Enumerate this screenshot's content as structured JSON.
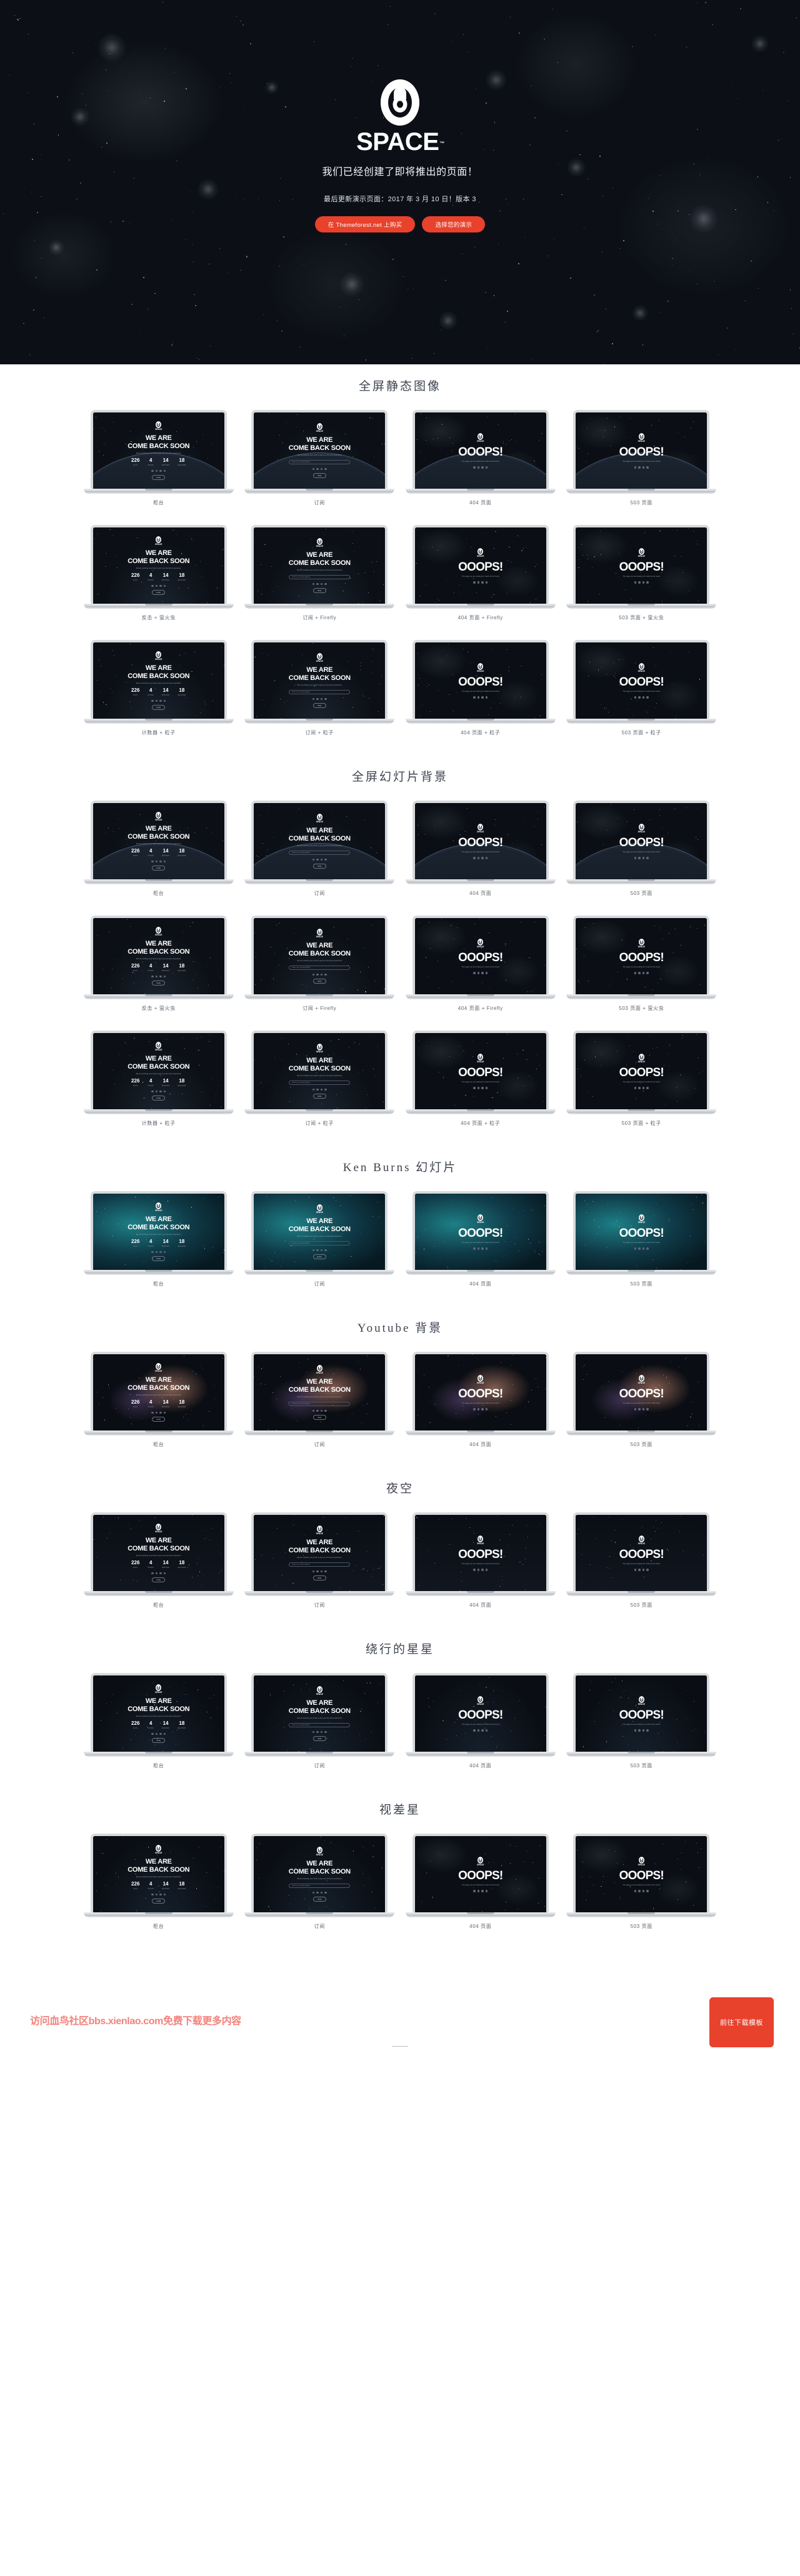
{
  "hero": {
    "logo_icon": "space-ring-keyhole-logo",
    "logo_word": "SPACE",
    "logo_tm": "™",
    "tagline": "我们已经创建了即将推出的页面！",
    "updated": "最后更新演示页面：2017 年 3 月 10 日！版本 3",
    "buttons": [
      {
        "label": "在 Themeforest.net 上购买",
        "name": "buy-on-themeforest-button"
      },
      {
        "label": "选择您的演示",
        "name": "choose-your-demo-button"
      }
    ],
    "accent_color": "#e8412c",
    "bg_color": "#0c1016"
  },
  "mock": {
    "logo_word": "SPACE",
    "heading_line1": "WE ARE",
    "heading_line2": "COME BACK SOON",
    "paragraph": "We are working very hard to give you the best experience",
    "countdown": [
      {
        "value": "226",
        "label": "DAYS"
      },
      {
        "value": "4",
        "label": "HOURS"
      },
      {
        "value": "14",
        "label": "MINUTES"
      },
      {
        "value": "18",
        "label": "SECONDS"
      }
    ],
    "notify_button": "Notify",
    "subscribe_placeholder": "Enter your email address",
    "error_text": "OOOPS!",
    "error_sub": "The page you are looking for could not be found"
  },
  "sections": [
    {
      "title": "全屏静态图像",
      "name": "section-fullscreen-static-image",
      "rows": [
        [
          {
            "caption": "柜台",
            "variant": "counter",
            "bg": "bg-dark",
            "arc": true
          },
          {
            "caption": "订阅",
            "variant": "subscribe",
            "bg": "bg-dark",
            "arc": true
          },
          {
            "caption": "404 页面",
            "variant": "error",
            "bg": "bg-space",
            "arc": true
          },
          {
            "caption": "503 页面",
            "variant": "error",
            "bg": "bg-space",
            "arc": true
          }
        ],
        [
          {
            "caption": "反击 + 萤火虫",
            "variant": "counter",
            "bg": "bg-dark",
            "arc": false
          },
          {
            "caption": "订阅 + Firefly",
            "variant": "subscribe",
            "bg": "bg-dark",
            "arc": false
          },
          {
            "caption": "404 页面 + Firefly",
            "variant": "error",
            "bg": "bg-space",
            "arc": false
          },
          {
            "caption": "503 页面 + 萤火虫",
            "variant": "error",
            "bg": "bg-space",
            "arc": false
          }
        ],
        [
          {
            "caption": "计数器 + 粒子",
            "variant": "counter",
            "bg": "bg-dark",
            "arc": false
          },
          {
            "caption": "订阅 + 粒子",
            "variant": "subscribe",
            "bg": "bg-dark",
            "arc": false
          },
          {
            "caption": "404 页面 + 粒子",
            "variant": "error",
            "bg": "bg-space",
            "arc": false
          },
          {
            "caption": "503 页面 + 粒子",
            "variant": "error",
            "bg": "bg-space",
            "arc": false
          }
        ]
      ]
    },
    {
      "title": "全屏幻灯片背景",
      "name": "section-fullscreen-slideshow-background",
      "rows": [
        [
          {
            "caption": "柜台",
            "variant": "counter",
            "bg": "bg-dark",
            "arc": true
          },
          {
            "caption": "订阅",
            "variant": "subscribe",
            "bg": "bg-dark",
            "arc": true
          },
          {
            "caption": "404 页面",
            "variant": "error",
            "bg": "bg-space",
            "arc": true
          },
          {
            "caption": "503 页面",
            "variant": "error",
            "bg": "bg-space",
            "arc": true
          }
        ],
        [
          {
            "caption": "反击 + 萤火虫",
            "variant": "counter",
            "bg": "bg-dark",
            "arc": false
          },
          {
            "caption": "订阅 + Firefly",
            "variant": "subscribe",
            "bg": "bg-dark",
            "arc": false
          },
          {
            "caption": "404 页面 + Firefly",
            "variant": "error",
            "bg": "bg-space",
            "arc": false
          },
          {
            "caption": "503 页面 + 萤火虫",
            "variant": "error",
            "bg": "bg-space",
            "arc": false
          }
        ],
        [
          {
            "caption": "计数器 + 粒子",
            "variant": "counter",
            "bg": "bg-dark",
            "arc": false
          },
          {
            "caption": "订阅 + 粒子",
            "variant": "subscribe",
            "bg": "bg-dark",
            "arc": false
          },
          {
            "caption": "404 页面 + 粒子",
            "variant": "error",
            "bg": "bg-space",
            "arc": false
          },
          {
            "caption": "503 页面 + 粒子",
            "variant": "error",
            "bg": "bg-space",
            "arc": false
          }
        ]
      ]
    },
    {
      "title": "Ken Burns 幻灯片",
      "name": "section-ken-burns-slideshow",
      "rows": [
        [
          {
            "caption": "柜台",
            "variant": "counter",
            "bg": "bg-teal",
            "arc": false
          },
          {
            "caption": "订阅",
            "variant": "subscribe",
            "bg": "bg-teal",
            "arc": false
          },
          {
            "caption": "404 页面",
            "variant": "error",
            "bg": "bg-teal",
            "arc": false
          },
          {
            "caption": "503 页面",
            "variant": "error",
            "bg": "bg-teal",
            "arc": false
          }
        ]
      ]
    },
    {
      "title": "Youtube 背景",
      "name": "section-youtube-background",
      "rows": [
        [
          {
            "caption": "柜台",
            "variant": "counter",
            "bg": "bg-neb",
            "arc": false
          },
          {
            "caption": "订阅",
            "variant": "subscribe",
            "bg": "bg-neb",
            "arc": false
          },
          {
            "caption": "404 页面",
            "variant": "error",
            "bg": "bg-neb",
            "arc": false
          },
          {
            "caption": "503 页面",
            "variant": "error",
            "bg": "bg-neb",
            "arc": false
          }
        ]
      ]
    },
    {
      "title": "夜空",
      "name": "section-night-sky",
      "rows": [
        [
          {
            "caption": "柜台",
            "variant": "counter",
            "bg": "bg-night",
            "arc": false
          },
          {
            "caption": "订阅",
            "variant": "subscribe",
            "bg": "bg-night",
            "arc": false
          },
          {
            "caption": "404 页面",
            "variant": "error",
            "bg": "bg-night",
            "arc": false
          },
          {
            "caption": "503 页面",
            "variant": "error",
            "bg": "bg-night",
            "arc": false
          }
        ]
      ]
    },
    {
      "title": "绕行的星星",
      "name": "section-orbiting-stars",
      "rows": [
        [
          {
            "caption": "柜台",
            "variant": "counter",
            "bg": "bg-orbit",
            "arc": false
          },
          {
            "caption": "订阅",
            "variant": "subscribe",
            "bg": "bg-orbit",
            "arc": false
          },
          {
            "caption": "404 页面",
            "variant": "error",
            "bg": "bg-orbit",
            "arc": false
          },
          {
            "caption": "503 页面",
            "variant": "error",
            "bg": "bg-orbit",
            "arc": false
          }
        ]
      ]
    },
    {
      "title": "视差星",
      "name": "section-parallax-stars",
      "rows": [
        [
          {
            "caption": "柜台",
            "variant": "counter",
            "bg": "bg-orbit",
            "arc": false
          },
          {
            "caption": "订阅",
            "variant": "subscribe",
            "bg": "bg-orbit",
            "arc": false
          },
          {
            "caption": "404 页面",
            "variant": "error",
            "bg": "bg-space",
            "arc": false
          },
          {
            "caption": "503 页面",
            "variant": "error",
            "bg": "bg-space",
            "arc": false
          }
        ]
      ]
    }
  ],
  "footer": {
    "watermark": "访问血鸟社区bbs.xienlao.com免费下载更多内容",
    "download_button": "前往下载模板",
    "watermark_color": "#f1827c",
    "button_color": "#e8412c"
  }
}
